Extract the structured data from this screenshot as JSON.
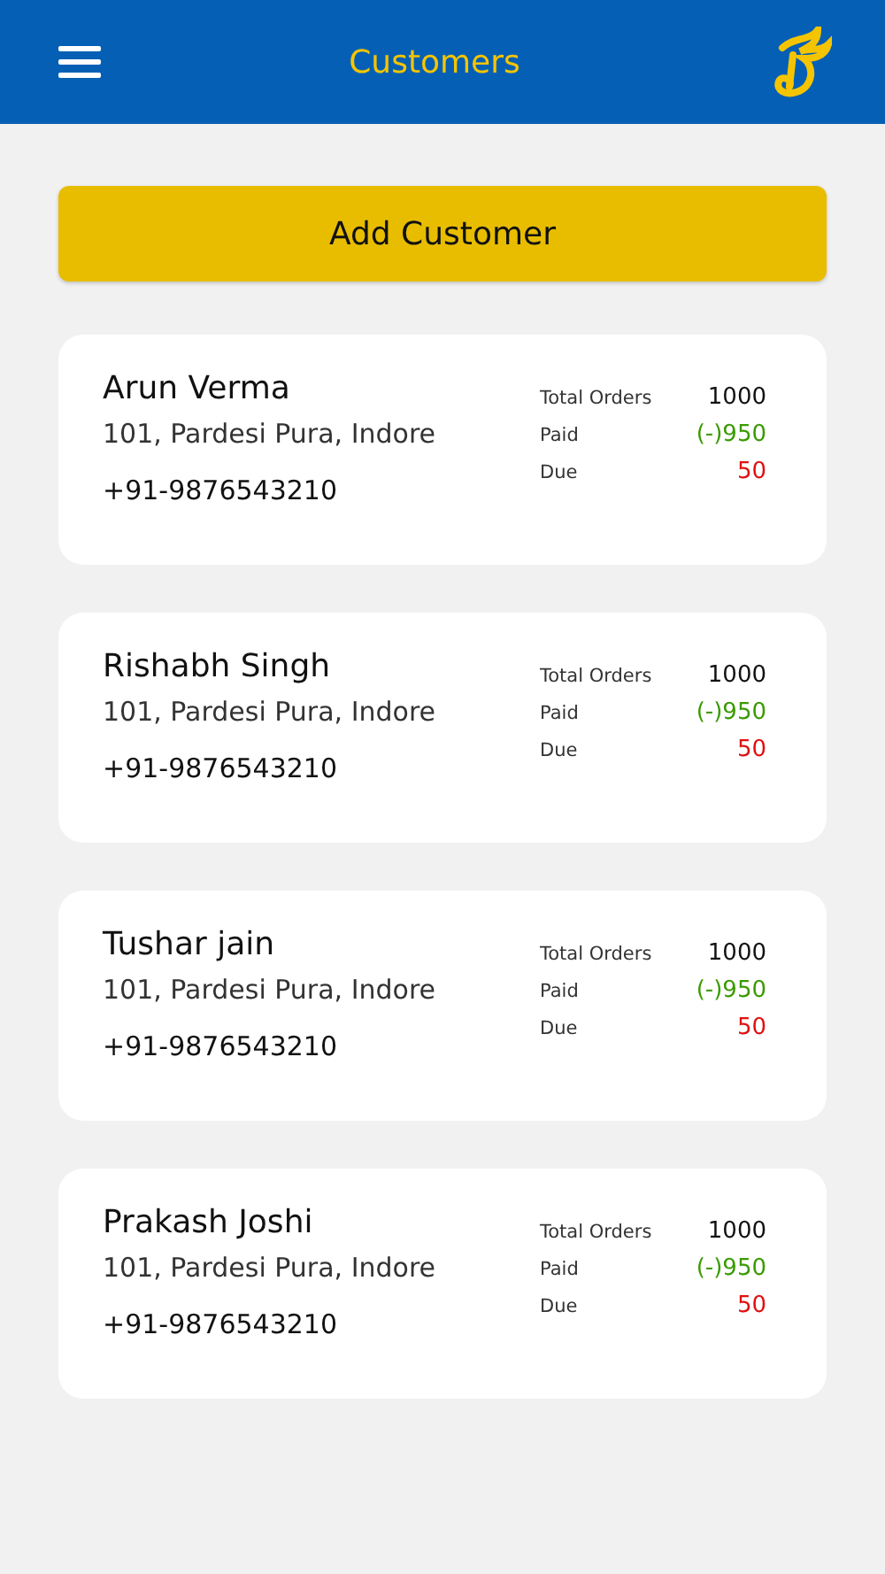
{
  "header": {
    "title": "Customers"
  },
  "add_button": {
    "label": "Add Customer"
  },
  "customers": [
    {
      "name": "Arun Verma",
      "address": "101, Pardesi Pura, Indore",
      "phone": "+91-9876543210",
      "stats": [
        {
          "label": "Total Orders",
          "value": "1000",
          "color": "#111111"
        },
        {
          "label": "Paid",
          "value": "(-)950",
          "color": "#3a9a00"
        },
        {
          "label": "Due",
          "value": "50",
          "color": "#e01010"
        }
      ]
    },
    {
      "name": "Rishabh Singh",
      "address": "101, Pardesi Pura, Indore",
      "phone": "+91-9876543210",
      "stats": [
        {
          "label": "Total Orders",
          "value": "1000",
          "color": "#111111"
        },
        {
          "label": "Paid",
          "value": "(-)950",
          "color": "#3a9a00"
        },
        {
          "label": "Due",
          "value": "50",
          "color": "#e01010"
        }
      ]
    },
    {
      "name": "Tushar jain",
      "address": "101, Pardesi Pura, Indore",
      "phone": "+91-9876543210",
      "stats": [
        {
          "label": "Total Orders",
          "value": "1000",
          "color": "#111111"
        },
        {
          "label": "Paid",
          "value": "(-)950",
          "color": "#3a9a00"
        },
        {
          "label": "Due",
          "value": "50",
          "color": "#e01010"
        }
      ]
    },
    {
      "name": "Prakash Joshi",
      "address": "101, Pardesi Pura, Indore",
      "phone": "+91-9876543210",
      "stats": [
        {
          "label": "Total Orders",
          "value": "1000",
          "color": "#111111"
        },
        {
          "label": "Paid",
          "value": "(-)950",
          "color": "#3a9a00"
        },
        {
          "label": "Due",
          "value": "50",
          "color": "#e01010"
        }
      ]
    }
  ]
}
